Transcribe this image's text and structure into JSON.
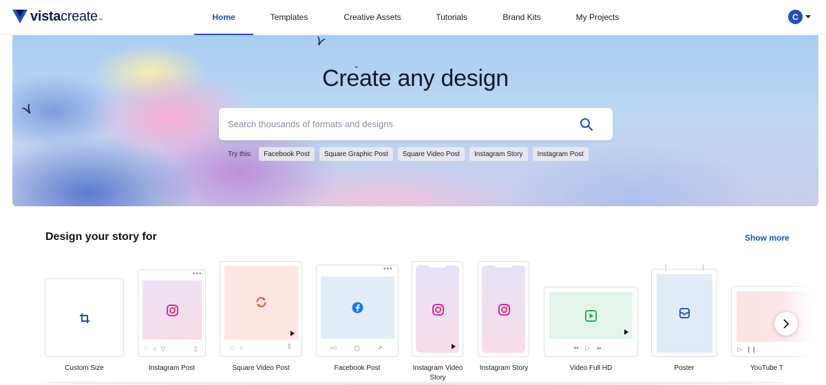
{
  "brand": {
    "name_bold": "vista",
    "name_regular": "create",
    "tm": "™"
  },
  "nav": {
    "items": [
      {
        "label": "Home",
        "active": true
      },
      {
        "label": "Templates"
      },
      {
        "label": "Creative Assets"
      },
      {
        "label": "Tutorials"
      },
      {
        "label": "Brand Kits"
      },
      {
        "label": "My Projects"
      }
    ]
  },
  "user": {
    "initial": "C"
  },
  "hero": {
    "title": "Create any design",
    "search_placeholder": "Search thousands of formats and designs",
    "try_label": "Try this:",
    "chips": [
      "Facebook Post",
      "Square Graphic Post",
      "Square Video Post",
      "Instagram Story",
      "Instagram Post"
    ]
  },
  "section": {
    "title": "Design your story for",
    "show_more": "Show more",
    "cards": [
      {
        "label": "Custom Size",
        "icon": "crop-icon"
      },
      {
        "label": "Instagram Post",
        "icon": "instagram-icon"
      },
      {
        "label": "Square Video Post",
        "icon": "refresh-icon"
      },
      {
        "label": "Facebook Post",
        "icon": "facebook-icon"
      },
      {
        "label": "Instagram Video Story",
        "icon": "instagram-icon"
      },
      {
        "label": "Instagram Story",
        "icon": "instagram-icon"
      },
      {
        "label": "Video Full HD",
        "icon": "play-icon"
      },
      {
        "label": "Poster",
        "icon": "poster-icon"
      },
      {
        "label": "YouTube T",
        "icon": "youtube-icon"
      }
    ]
  },
  "colors": {
    "accent": "#1f4fbf",
    "instagram": "#d6249f",
    "facebook": "#1877f2",
    "video_green": "#2e9e5b",
    "refresh_red": "#e0533a"
  }
}
